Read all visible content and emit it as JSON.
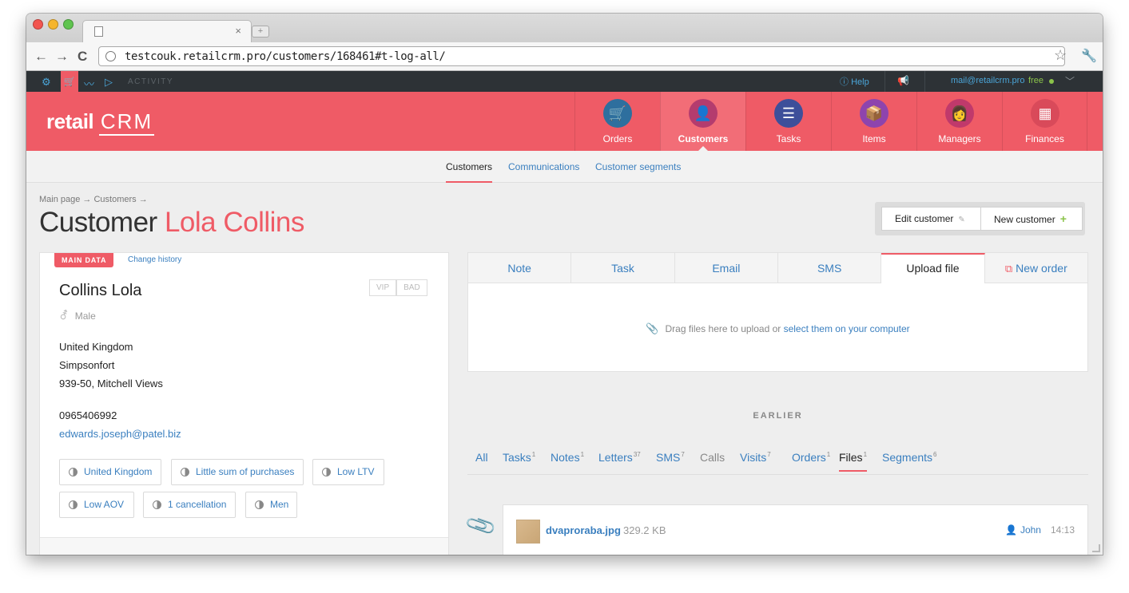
{
  "browser": {
    "url": "testcouk.retailcrm.pro/customers/168461#t-log-all/",
    "tab_close": "×",
    "new_tab": "+"
  },
  "topbar": {
    "activity": "ACTIVITY",
    "help": "Help",
    "email": "mail@retailcrm.pro",
    "plan": "free"
  },
  "logo": {
    "left": "retail",
    "right": "CRM"
  },
  "modules": [
    {
      "label": "Orders",
      "icon": "🛒",
      "color": "#2e6f9e"
    },
    {
      "label": "Customers",
      "icon": "👤",
      "color": "#b43c6e"
    },
    {
      "label": "Tasks",
      "icon": "☰",
      "color": "#3d4f9a"
    },
    {
      "label": "Items",
      "icon": "📦",
      "color": "#8e44ad"
    },
    {
      "label": "Managers",
      "icon": "👩",
      "color": "#c0396b"
    },
    {
      "label": "Finances",
      "icon": "▦",
      "color": "#d94a5a"
    }
  ],
  "subnav": {
    "customers": "Customers",
    "communications": "Communications",
    "segments": "Customer segments"
  },
  "breadcrumb": "Main page → Customers →",
  "title": {
    "prefix": "Customer",
    "name": "Lola Collins"
  },
  "buttons": {
    "edit": "Edit customer",
    "new": "New customer"
  },
  "customer": {
    "badge": "MAIN DATA",
    "change_history": "Change history",
    "name": "Collins Lola",
    "vip": "VIP",
    "bad": "BAD",
    "gender": "Male",
    "country": "United Kingdom",
    "city": "Simpsonfort",
    "street": "939-50, Mitchell Views",
    "phone": "0965406992",
    "email": "edwards.joseph@patel.biz",
    "segments": [
      "United Kingdom",
      "Little sum of purchases",
      "Low LTV",
      "Low AOV",
      "1 cancellation",
      "Men"
    ]
  },
  "actions": {
    "tabs": [
      "Note",
      "Task",
      "Email",
      "SMS",
      "Upload file"
    ],
    "new_order": "New order",
    "drop_text": "Drag files here to upload or",
    "drop_link": "select them on your computer"
  },
  "history": {
    "earlier": "EARLIER",
    "filters": [
      {
        "label": "All",
        "count": ""
      },
      {
        "label": "Tasks",
        "count": "1"
      },
      {
        "label": "Notes",
        "count": "1"
      },
      {
        "label": "Letters",
        "count": "37"
      },
      {
        "label": "SMS",
        "count": "7"
      },
      {
        "label": "Calls",
        "count": ""
      },
      {
        "label": "Visits",
        "count": "7"
      },
      {
        "label": "Orders",
        "count": "1"
      },
      {
        "label": "Files",
        "count": "1"
      },
      {
        "label": "Segments",
        "count": "6"
      }
    ],
    "file": {
      "name": "dvaproraba.jpg",
      "size": "329.2 KB",
      "user": "John",
      "time": "14:13"
    }
  }
}
